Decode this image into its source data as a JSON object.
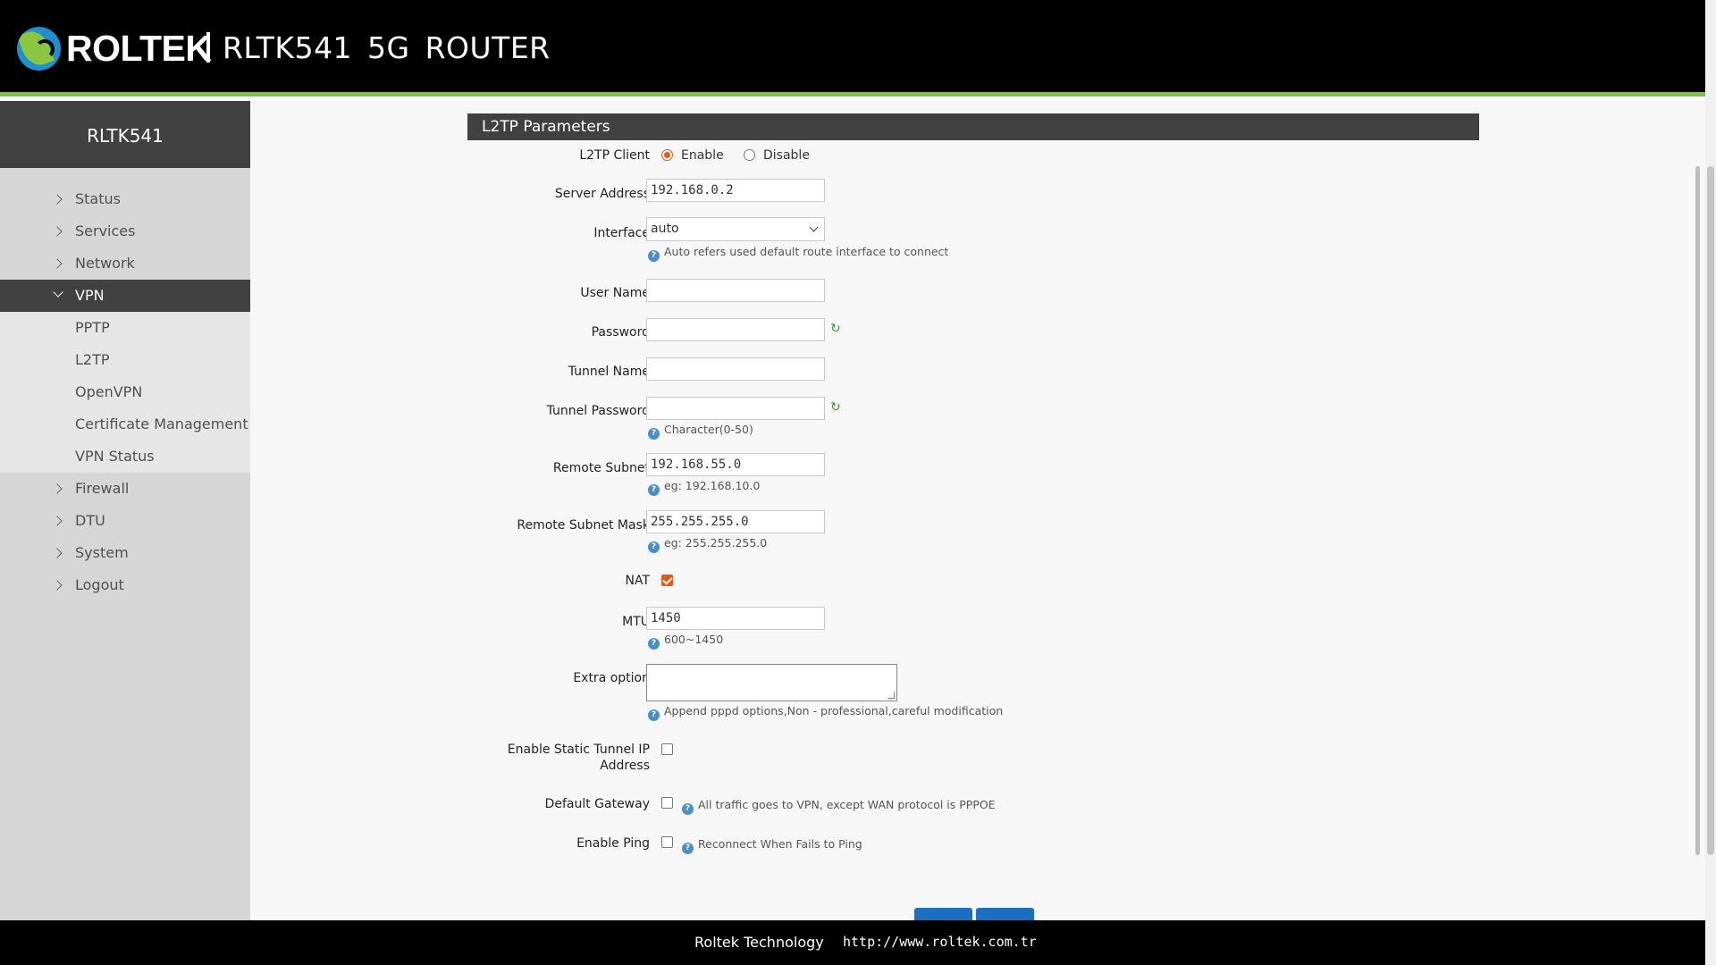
{
  "header": {
    "brand": "ROLTEK",
    "model": "RLTK541 5G ROUTER"
  },
  "sidebar": {
    "title": "RLTK541",
    "items": [
      {
        "label": "Status"
      },
      {
        "label": "Services"
      },
      {
        "label": "Network"
      },
      {
        "label": "VPN",
        "expanded": true
      },
      {
        "label": "Firewall"
      },
      {
        "label": "DTU"
      },
      {
        "label": "System"
      },
      {
        "label": "Logout"
      }
    ],
    "vpn_children": [
      {
        "label": "PPTP"
      },
      {
        "label": "L2TP"
      },
      {
        "label": "OpenVPN"
      },
      {
        "label": "Certificate Management"
      },
      {
        "label": "VPN Status"
      }
    ]
  },
  "form": {
    "section_title": "L2TP Parameters",
    "l2tp_client": {
      "label": "L2TP Client",
      "enable_label": "Enable",
      "disable_label": "Disable",
      "selected": "Enable"
    },
    "server_address": {
      "label": "Server Address",
      "value": "192.168.0.2"
    },
    "interface": {
      "label": "Interface",
      "value": "auto",
      "hint": "Auto refers used default route interface to connect"
    },
    "user_name": {
      "label": "User Name",
      "value": ""
    },
    "password": {
      "label": "Password",
      "value": ""
    },
    "tunnel_name": {
      "label": "Tunnel Name",
      "value": ""
    },
    "tunnel_password": {
      "label": "Tunnel Password",
      "value": "",
      "hint": "Character(0-50)"
    },
    "remote_subnet": {
      "label": "Remote Subnet",
      "value": "192.168.55.0",
      "hint": "eg: 192.168.10.0"
    },
    "remote_subnet_mask": {
      "label": "Remote Subnet Mask",
      "value": "255.255.255.0",
      "hint": "eg: 255.255.255.0"
    },
    "nat": {
      "label": "NAT",
      "checked": true
    },
    "mtu": {
      "label": "MTU",
      "value": "1450",
      "hint": "600~1450"
    },
    "extra_option": {
      "label": "Extra option",
      "value": "",
      "hint": "Append pppd options,Non - professional,careful modification"
    },
    "static_tunnel_ip": {
      "label_line1": "Enable Static Tunnel IP",
      "label_line2": "Address",
      "checked": false
    },
    "default_gateway": {
      "label": "Default Gateway",
      "checked": false,
      "hint": "All traffic goes to VPN, except WAN protocol is PPPOE"
    },
    "enable_ping": {
      "label": "Enable Ping",
      "checked": false,
      "hint": "Reconnect When Fails to Ping"
    }
  },
  "footer": {
    "company": "Roltek Technology",
    "url": "http://www.roltek.com.tr"
  },
  "colors": {
    "accent_green": "#7cc142",
    "radio_checked": "#e05a1a",
    "button_blue": "#1a6fc0"
  }
}
